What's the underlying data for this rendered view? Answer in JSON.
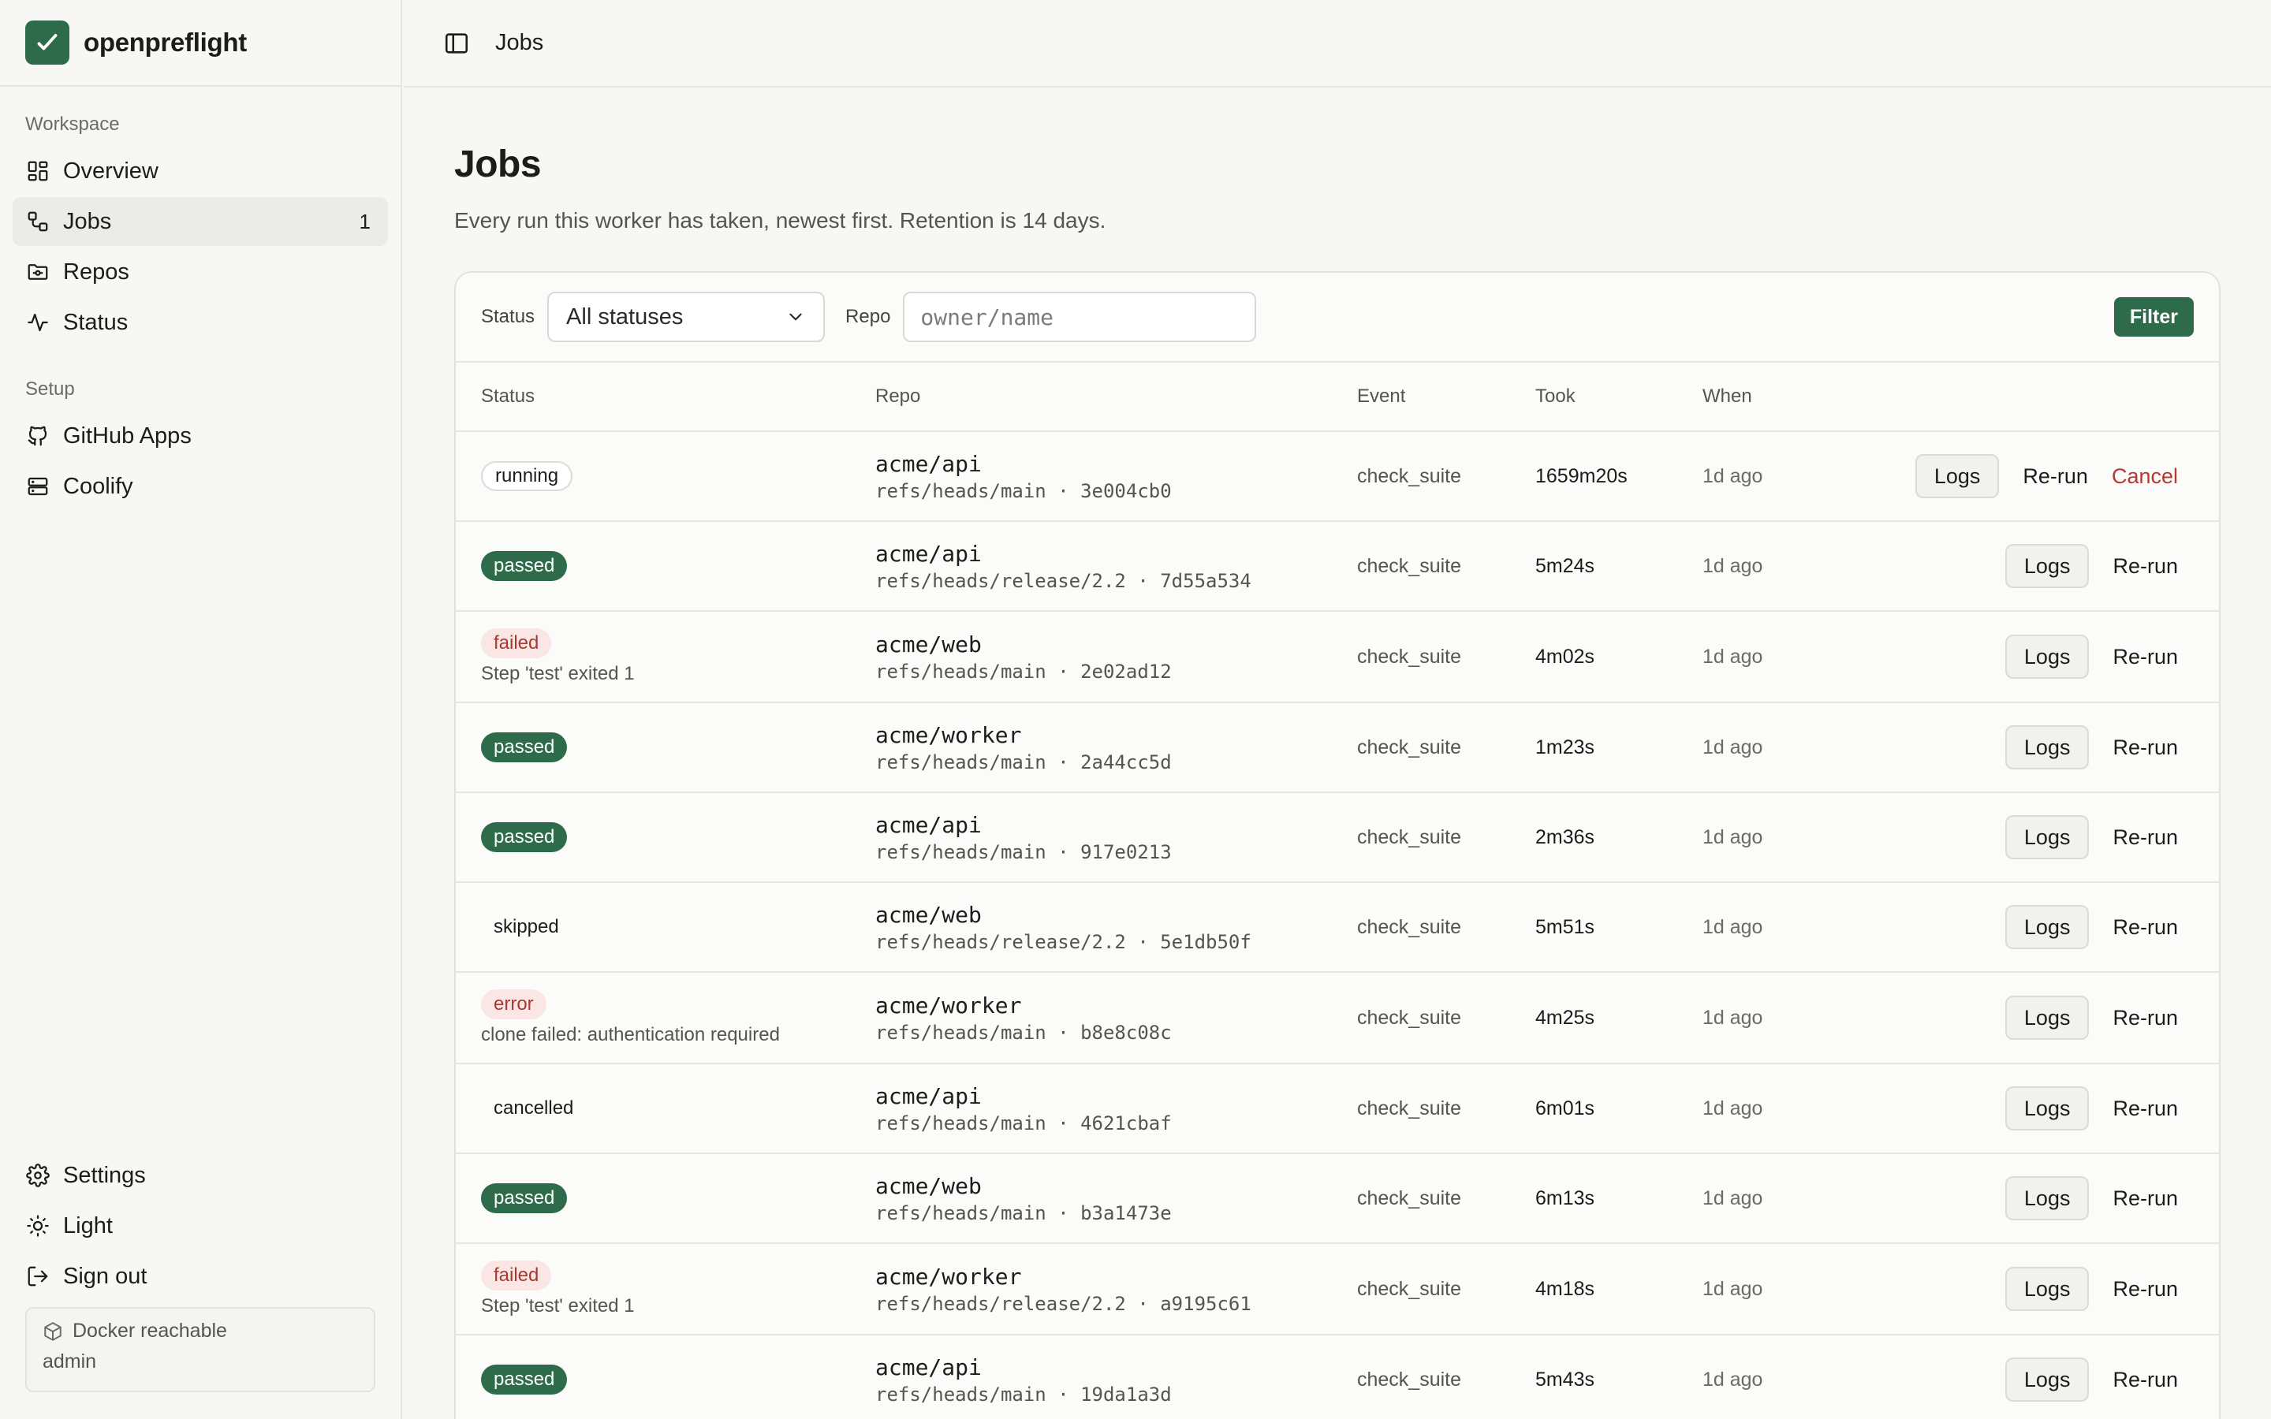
{
  "app": {
    "name": "openpreflight"
  },
  "colors": {
    "accent": "#2e6b4a",
    "danger": "#b33a2f",
    "danger_bg": "#fae6e4"
  },
  "sidebar": {
    "workspace_heading": "Workspace",
    "workspace_items": [
      {
        "label": "Overview",
        "icon": "grid-icon"
      },
      {
        "label": "Jobs",
        "icon": "workflow-icon",
        "count": "1",
        "active": true
      },
      {
        "label": "Repos",
        "icon": "folder-git-icon"
      },
      {
        "label": "Status",
        "icon": "activity-icon"
      }
    ],
    "setup_heading": "Setup",
    "setup_items": [
      {
        "label": "GitHub Apps",
        "icon": "github-icon"
      },
      {
        "label": "Coolify",
        "icon": "server-icon"
      }
    ],
    "bottom_items": [
      {
        "label": "Settings",
        "icon": "gear-icon"
      },
      {
        "label": "Light",
        "icon": "sun-icon"
      },
      {
        "label": "Sign out",
        "icon": "logout-icon"
      }
    ],
    "env": {
      "docker": "Docker reachable",
      "user": "admin"
    }
  },
  "topbar": {
    "crumb": "Jobs"
  },
  "page": {
    "title": "Jobs",
    "subtitle": "Every run this worker has taken, newest first. Retention is 14 days."
  },
  "filters": {
    "status_label": "Status",
    "status_value": "All statuses",
    "repo_label": "Repo",
    "repo_placeholder": "owner/name",
    "button": "Filter"
  },
  "table": {
    "headers": {
      "status": "Status",
      "repo": "Repo",
      "event": "Event",
      "took": "Took",
      "when": "When"
    },
    "actions": {
      "logs": "Logs",
      "rerun": "Re-run",
      "cancel": "Cancel"
    },
    "rows": [
      {
        "status": "running",
        "note": "",
        "repo": "acme/api",
        "ref": "refs/heads/main · 3e004cb0",
        "event": "check_suite",
        "took": "1659m20s",
        "when": "1d ago"
      },
      {
        "status": "passed",
        "note": "",
        "repo": "acme/api",
        "ref": "refs/heads/release/2.2 · 7d55a534",
        "event": "check_suite",
        "took": "5m24s",
        "when": "1d ago"
      },
      {
        "status": "failed",
        "note": "Step 'test' exited 1",
        "repo": "acme/web",
        "ref": "refs/heads/main · 2e02ad12",
        "event": "check_suite",
        "took": "4m02s",
        "when": "1d ago"
      },
      {
        "status": "passed",
        "note": "",
        "repo": "acme/worker",
        "ref": "refs/heads/main · 2a44cc5d",
        "event": "check_suite",
        "took": "1m23s",
        "when": "1d ago"
      },
      {
        "status": "passed",
        "note": "",
        "repo": "acme/api",
        "ref": "refs/heads/main · 917e0213",
        "event": "check_suite",
        "took": "2m36s",
        "when": "1d ago"
      },
      {
        "status": "skipped",
        "note": "",
        "repo": "acme/web",
        "ref": "refs/heads/release/2.2 · 5e1db50f",
        "event": "check_suite",
        "took": "5m51s",
        "when": "1d ago"
      },
      {
        "status": "error",
        "note": "clone failed: authentication required",
        "repo": "acme/worker",
        "ref": "refs/heads/main · b8e8c08c",
        "event": "check_suite",
        "took": "4m25s",
        "when": "1d ago"
      },
      {
        "status": "cancelled",
        "note": "",
        "repo": "acme/api",
        "ref": "refs/heads/main · 4621cbaf",
        "event": "check_suite",
        "took": "6m01s",
        "when": "1d ago"
      },
      {
        "status": "passed",
        "note": "",
        "repo": "acme/web",
        "ref": "refs/heads/main · b3a1473e",
        "event": "check_suite",
        "took": "6m13s",
        "when": "1d ago"
      },
      {
        "status": "failed",
        "note": "Step 'test' exited 1",
        "repo": "acme/worker",
        "ref": "refs/heads/release/2.2 · a9195c61",
        "event": "check_suite",
        "took": "4m18s",
        "when": "1d ago"
      },
      {
        "status": "passed",
        "note": "",
        "repo": "acme/api",
        "ref": "refs/heads/main · 19da1a3d",
        "event": "check_suite",
        "took": "5m43s",
        "when": "1d ago"
      }
    ]
  }
}
